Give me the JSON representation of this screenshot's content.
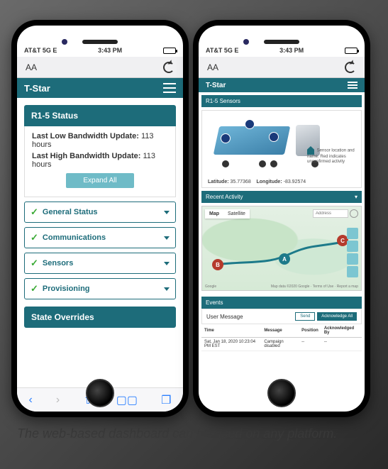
{
  "status_bar": {
    "carrier": "AT&T 5G E",
    "signal_icon": "signal-icon",
    "time": "3:43 PM",
    "battery_icon": "battery-icon"
  },
  "toolbar": {
    "text_size_label": "AA",
    "reload_icon": "reload-icon"
  },
  "appbar": {
    "title": "T-Star",
    "menu_icon": "hamburger-icon"
  },
  "phone1": {
    "status_panel": {
      "title": "R1-5 Status",
      "rows": [
        {
          "label": "Last Low Bandwidth Update:",
          "value": "113 hours"
        },
        {
          "label": "Last High Bandwidth Update:",
          "value": "113 hours"
        }
      ],
      "expand_label": "Expand All"
    },
    "accordions": [
      {
        "label": "General Status",
        "ok": true
      },
      {
        "label": "Communications",
        "ok": true
      },
      {
        "label": "Sensors",
        "ok": true
      },
      {
        "label": "Provisioning",
        "ok": true
      }
    ],
    "overrides_title": "State Overrides",
    "bottom_nav": {
      "back_icon": "chevron-left-icon",
      "forward_icon": "chevron-right-icon",
      "share_icon": "share-icon",
      "bookmarks_icon": "book-icon",
      "tabs_icon": "tabs-icon"
    }
  },
  "phone2": {
    "sensors_title": "R1-5 Sensors",
    "legend_text": "Sensor location and name. Red indicates unconfirmed activity",
    "coords": {
      "lat_label": "Latitude:",
      "lat": "35.77368",
      "lon_label": "Longitude:",
      "lon": "-83.92574"
    },
    "recent_title": "Recent Activity",
    "map": {
      "tabs": [
        "Map",
        "Satellite"
      ],
      "active_tab": "Map",
      "search_placeholder": "Address",
      "pins": [
        "A",
        "B",
        "C"
      ],
      "controls": [
        "layers-icon",
        "center-icon",
        "night-icon",
        "info-icon"
      ],
      "footer_left": "Google",
      "footer_right": "Map data ©2020 Google · Terms of Use · Report a map"
    },
    "events": {
      "title": "Events",
      "user_message_label": "User Message",
      "send_label": "Send",
      "ack_all_label": "Acknowledge All",
      "columns": [
        "Time",
        "Message",
        "Position",
        "Acknowledged By"
      ],
      "rows": [
        {
          "time": "Sat, Jan 18, 2020 10:23:04 PM EST",
          "message": "Campaign disabled",
          "position": "--",
          "ack": "--"
        }
      ]
    }
  },
  "caption": "The web-based dashboard can be used on any platform."
}
